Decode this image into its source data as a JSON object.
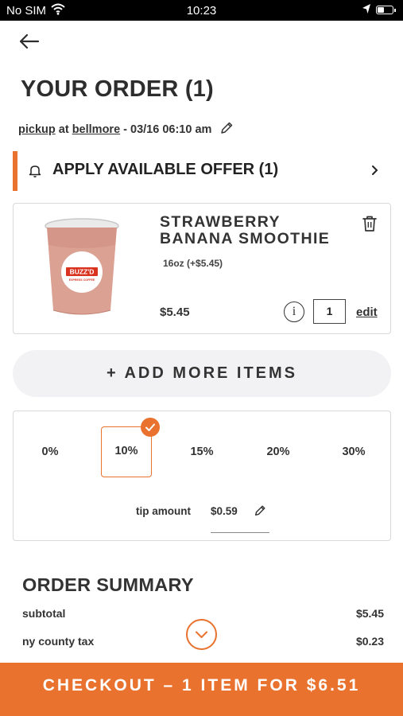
{
  "status_bar": {
    "carrier": "No SIM",
    "time": "10:23"
  },
  "header": {
    "back_icon": "arrow-left-icon",
    "title": "YOUR ORDER (1)"
  },
  "pickup": {
    "mode": "pickup",
    "at": "at",
    "location": "bellmore",
    "datetime": "- 03/16 06:10 am"
  },
  "offer": {
    "label": "APPLY AVAILABLE OFFER (1)",
    "icon": "bell-icon"
  },
  "cart_item": {
    "name": "STRAWBERRY BANANA SMOOTHIE",
    "option": "16oz (+$5.45)",
    "price": "$5.45",
    "quantity": "1",
    "info_label": "i",
    "edit_label": "edit",
    "cup_logo": "BUZZ'D",
    "cup_subtext": "EXPRESS COFFEE"
  },
  "add_more": {
    "label": "+ ADD MORE ITEMS"
  },
  "tip": {
    "options": [
      "0%",
      "10%",
      "15%",
      "20%",
      "30%"
    ],
    "selected": "10%",
    "amount_label": "tip amount",
    "amount_value": "$0.59"
  },
  "summary": {
    "title": "ORDER SUMMARY",
    "subtotal_label": "subtotal",
    "subtotal_value": "$5.45",
    "tax_label": "ny county tax",
    "tax_value": "$0.23"
  },
  "checkout": {
    "label": "CHECKOUT – 1 ITEM FOR $6.51"
  },
  "colors": {
    "accent": "#e8722e",
    "add_more_bg": "#f2f2f4",
    "border": "#d9d9d9",
    "text": "#2b2b2b"
  }
}
